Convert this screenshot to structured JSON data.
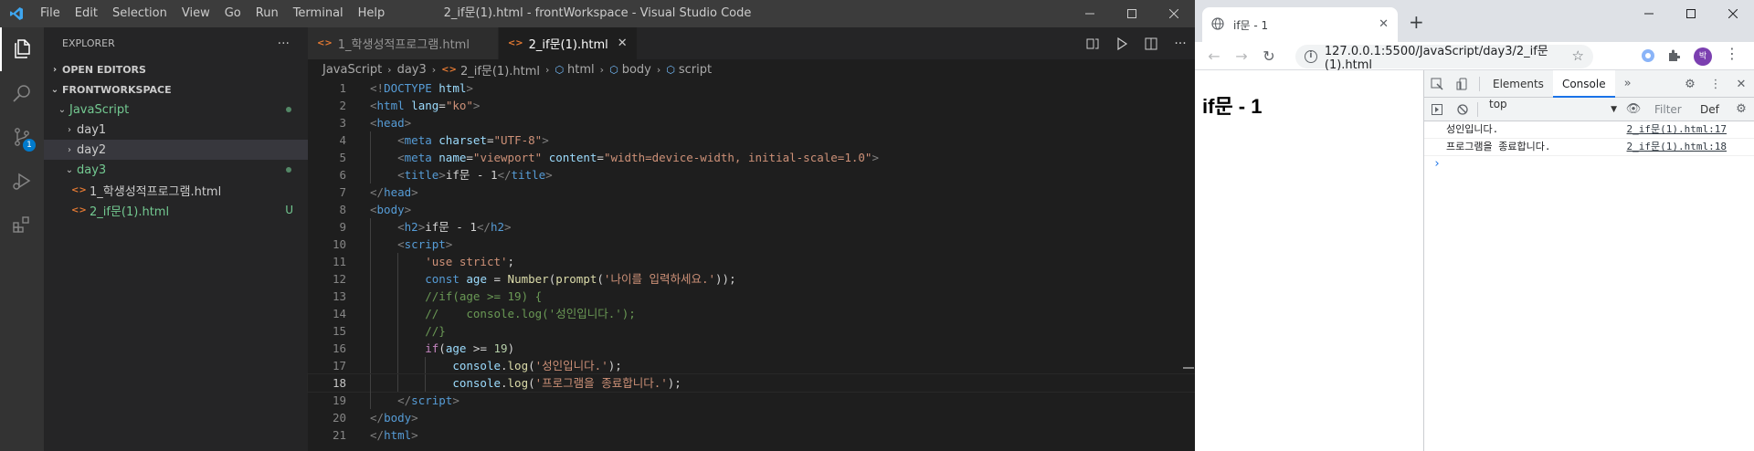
{
  "vscode": {
    "menu": [
      "File",
      "Edit",
      "Selection",
      "View",
      "Go",
      "Run",
      "Terminal",
      "Help"
    ],
    "window_title": "2_if문(1).html - frontWorkspace - Visual Studio Code",
    "scm_badge": "1",
    "sidebar": {
      "title": "EXPLORER",
      "more": "···",
      "open_editors": "OPEN EDITORS",
      "workspace": "FRONTWORKSPACE",
      "folder_js": "JavaScript",
      "day1": "day1",
      "day2": "day2",
      "day3": "day3",
      "file1": "1_학생성적프로그램.html",
      "file2": "2_if문(1).html",
      "file2_status": "U"
    },
    "tabs": [
      "1_학생성적프로그램.html",
      "2_if문(1).html"
    ],
    "breadcrumb": [
      "JavaScript",
      "day3",
      "2_if문(1).html",
      "html",
      "body",
      "script"
    ],
    "current_line": 18
  },
  "chrome": {
    "tab_title": "if문 - 1",
    "url": "127.0.0.1:5500/JavaScript/day3/2_if문(1).html",
    "avatar_text": "박",
    "page_heading": "if문 - 1",
    "devtools": {
      "tabs": [
        "Elements",
        "Console"
      ],
      "context": "top",
      "filter_placeholder": "Filter",
      "levels": "Def",
      "logs": [
        {
          "message": "성인입니다.",
          "source": "2_if문(1).html:17"
        },
        {
          "message": "프로그램을 종료합니다.",
          "source": "2_if문(1).html:18"
        }
      ],
      "prompt": "›"
    }
  }
}
